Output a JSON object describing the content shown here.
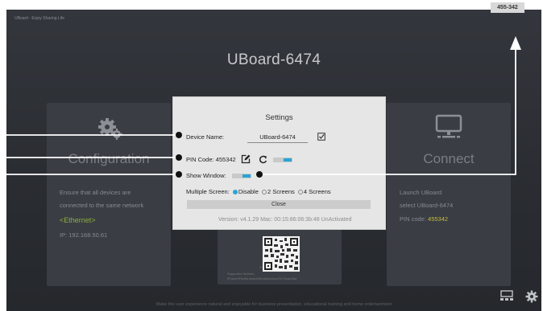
{
  "app": {
    "brand": "UBoard - Enjoy Sharing Life",
    "title": "UBoard-6474",
    "top_code": "455-342",
    "footer": "Make the user experience natural and enjoyable for business presentation, educational training and home entertainment"
  },
  "cards": {
    "configuration": {
      "heading": "Configuration",
      "line1": "Ensure that all devices are",
      "line2": "connected to the same network",
      "network": "<Ethernet>",
      "ip": "IP: 192.168.50.61"
    },
    "middle": {
      "qr_caption": "Click to enlarge",
      "supported": "Supported devices:",
      "supported_list": "iPhone/iPad/Android/Windows/mac/HZ Board/Air"
    },
    "connect": {
      "heading": "Connect",
      "line1": "Launch UBoard",
      "line2": "select UBoard-6474",
      "pin_label": "PIN code:",
      "pin_value": "455342"
    }
  },
  "settings": {
    "title": "Settings",
    "device_name_label": "Device Name:",
    "device_name_value": "UBoard-6474",
    "pin_label": "PIN Code: 455342",
    "pin_toggle": "ON",
    "show_window_label": "Show Window:",
    "show_window_toggle": "ON",
    "multiple_screen_label": "Multiple Screen:",
    "options": [
      "Disable",
      "2 Screens",
      "4 Screens"
    ],
    "selected_option": "Disable",
    "close_label": "Close",
    "version": "Version: v4.1.29   Mac: 00:15:86:06:3b:48  UnActivated"
  },
  "colors": {
    "accent_blue": "#2aa4d4",
    "network_green": "#8dae3c",
    "pin_yellow": "#c9ba39"
  },
  "icons": [
    "gear-icon",
    "monitor-icon",
    "edit-icon",
    "refresh-icon",
    "check-icon",
    "settings-gear-icon",
    "screens-icon",
    "qr-code-icon"
  ]
}
